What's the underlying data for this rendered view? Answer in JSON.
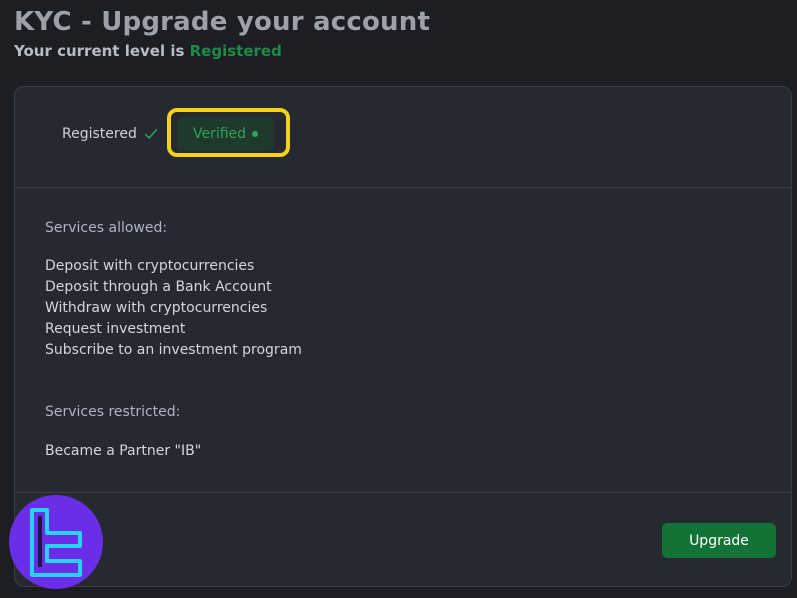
{
  "header": {
    "title": "KYC - Upgrade your account",
    "subtitle_prefix": "Your current level is ",
    "current_level": "Registered"
  },
  "steps": {
    "registered_label": "Registered",
    "verified_label": "Verified"
  },
  "services_allowed": {
    "heading": "Services allowed:",
    "items": [
      "Deposit with cryptocurrencies",
      "Deposit through a Bank Account",
      "Withdraw with cryptocurrencies",
      "Request investment",
      "Subscribe to an investment program"
    ]
  },
  "services_restricted": {
    "heading": "Services restricted:",
    "items": [
      "Became a Partner \"IB\""
    ]
  },
  "actions": {
    "upgrade_label": "Upgrade"
  },
  "colors": {
    "accent_green": "#137235",
    "level_green": "#1f8a46",
    "highlight_yellow": "#f2d21c",
    "logo_purple": "#6a2ee8",
    "logo_cyan": "#27d3ee"
  },
  "icons": {
    "registered_status": "check-icon",
    "verified_status": "dot-icon",
    "watermark": "tradingfinder-logo-icon"
  }
}
